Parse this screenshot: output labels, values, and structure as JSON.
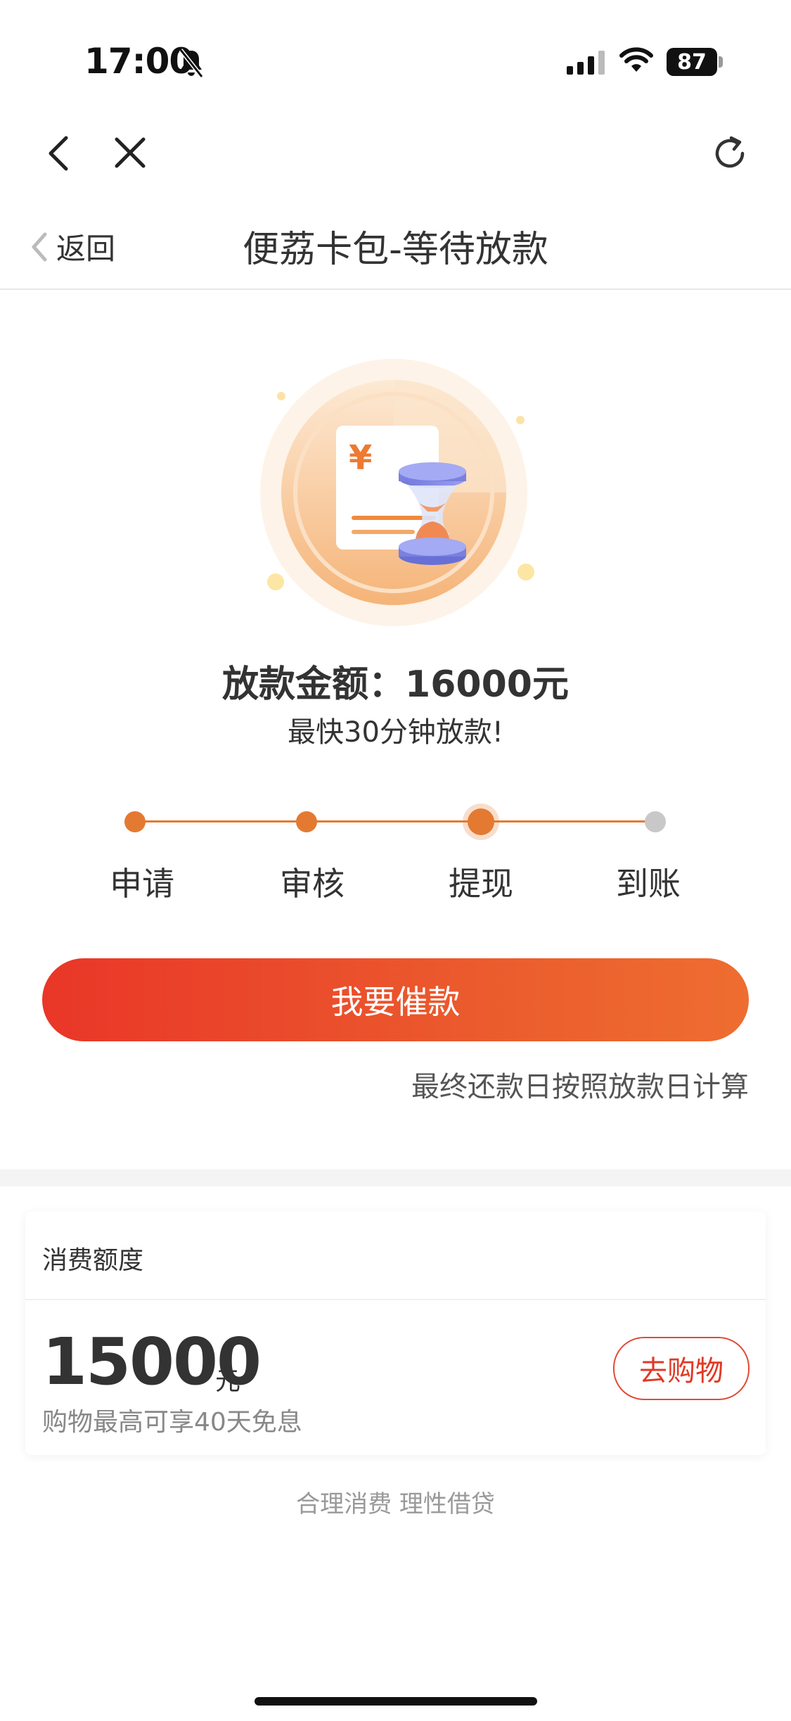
{
  "status_bar": {
    "time": "17:00",
    "battery": "87"
  },
  "header": {
    "back_label": "返回",
    "title": "便荔卡包-等待放款"
  },
  "loan": {
    "amount_text": "放款金额：16000元",
    "subtitle": "最快30分钟放款!"
  },
  "steps": [
    {
      "label": "申请",
      "state": "done"
    },
    {
      "label": "审核",
      "state": "done"
    },
    {
      "label": "提现",
      "state": "current"
    },
    {
      "label": "到账",
      "state": "todo"
    }
  ],
  "actions": {
    "urge_label": "我要催款",
    "repay_note": "最终还款日按照放款日计算"
  },
  "credit_card": {
    "title": "消费额度",
    "value": "15000",
    "unit": "元",
    "description": "购物最高可享40天免息",
    "shop_label": "去购物"
  },
  "footer": {
    "slogan": "合理消费 理性借贷"
  },
  "colors": {
    "accent": "#e47a32",
    "button_start": "#e93628",
    "button_end": "#ee6d30",
    "shop_red": "#e03a25"
  }
}
